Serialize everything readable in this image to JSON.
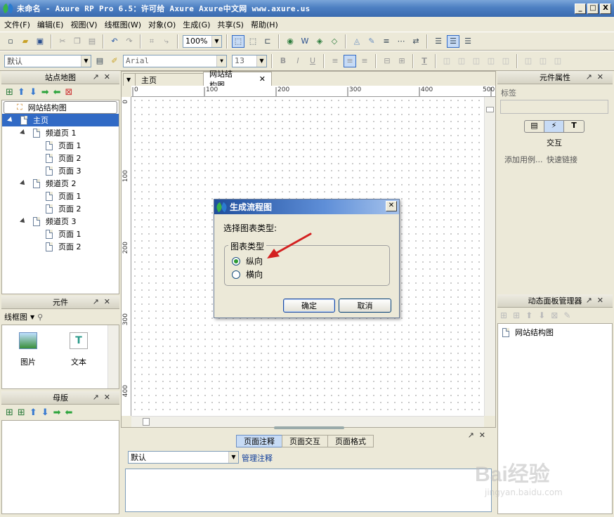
{
  "window": {
    "title": "未命名 - Axure RP Pro 6.5：许可给 Axure Axure中文网 www.axure.us",
    "buttons": [
      "_",
      "□",
      "X"
    ]
  },
  "menu": {
    "items": [
      "文件(F)",
      "编辑(E)",
      "视图(V)",
      "线框图(W)",
      "对象(O)",
      "生成(G)",
      "共享(S)",
      "帮助(H)"
    ]
  },
  "toolbar": {
    "zoom": "100%",
    "style_select": "默认",
    "font_family": "Arial",
    "font_size": "13",
    "bold": "B",
    "italic": "I",
    "underline": "U",
    "text_color": "T"
  },
  "sitemap": {
    "title": "站点地图",
    "root": "网站结构图",
    "items": [
      {
        "label": "主页",
        "selected": true
      },
      {
        "label": "频道页 1"
      },
      {
        "label": "页面 1"
      },
      {
        "label": "页面 2"
      },
      {
        "label": "页面 3"
      },
      {
        "label": "频道页 2"
      },
      {
        "label": "页面 1"
      },
      {
        "label": "页面 2"
      },
      {
        "label": "频道页 3"
      },
      {
        "label": "页面 1"
      },
      {
        "label": "页面 2"
      }
    ]
  },
  "widgets": {
    "title": "元件",
    "library": "线框图",
    "items": [
      "图片",
      "文本"
    ]
  },
  "masters": {
    "title": "母版"
  },
  "editor": {
    "tabs": [
      "主页",
      "网站结构图"
    ],
    "ruler_h": [
      "0",
      "100",
      "200",
      "300",
      "400",
      "500"
    ],
    "ruler_v": [
      "0",
      "100",
      "200",
      "300",
      "400"
    ]
  },
  "dialog": {
    "title": "生成流程图",
    "prompt": "选择图表类型:",
    "group": "图表类型",
    "options": [
      {
        "label": "纵向",
        "selected": true
      },
      {
        "label": "横向",
        "selected": false
      }
    ],
    "ok": "确定",
    "cancel": "取消"
  },
  "notes": {
    "tabs": [
      "页面注释",
      "页面交互",
      "页面格式"
    ],
    "select": "默认",
    "manage_link": "管理注释"
  },
  "widget_props": {
    "title": "元件属性",
    "label_caption": "标签",
    "section": "交互",
    "add_case": "添加用例...",
    "quick_link": "快速链接"
  },
  "dynamic_panel": {
    "title": "动态面板管理器",
    "item": "网站结构图"
  },
  "watermark": {
    "brand": "Bai经验",
    "url": "jingyan.baidu.com"
  },
  "colors": {
    "title_bar": "#3a6bb0",
    "selection": "#316ac5",
    "dialog_title": "#1f4e9c",
    "annotation_arrow": "#d32020"
  }
}
